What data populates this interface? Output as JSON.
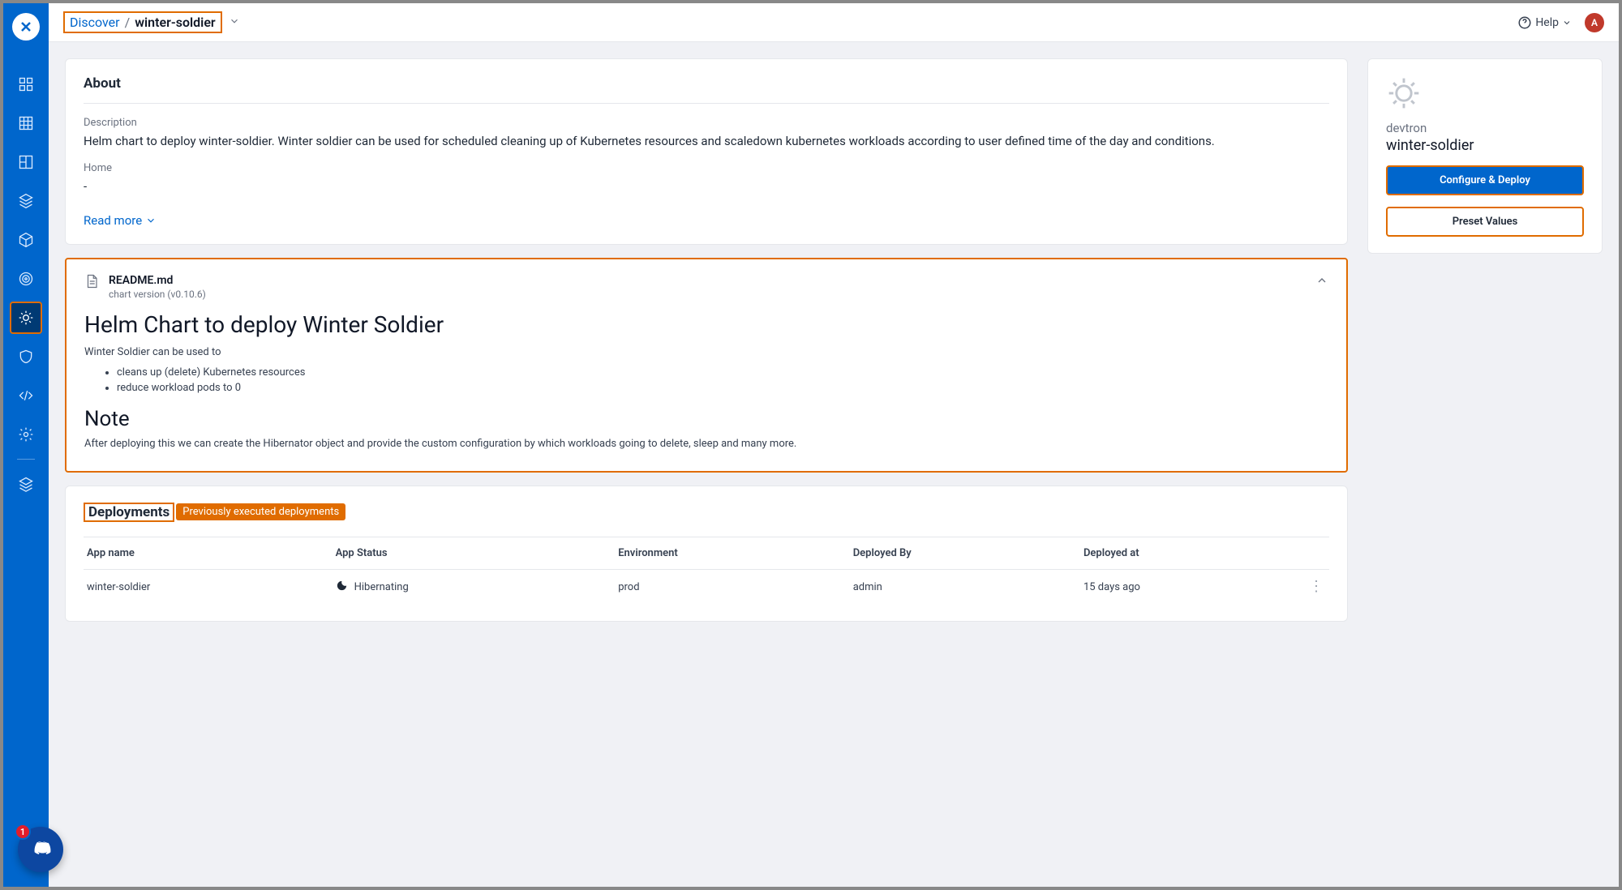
{
  "breadcrumb": {
    "root": "Discover",
    "current": "winter-soldier"
  },
  "topbar": {
    "help_label": "Help",
    "avatar_initial": "A"
  },
  "discord_badge": "1",
  "about": {
    "title": "About",
    "description_label": "Description",
    "description": "Helm chart to deploy winter-soldier. Winter soldier can be used for scheduled cleaning up of Kubernetes resources and scaledown kubernetes workloads according to user defined time of the day and conditions.",
    "home_label": "Home",
    "home_value": "-",
    "read_more": "Read more"
  },
  "readme": {
    "filename": "README.md",
    "version": "chart version (v0.10.6)",
    "h1": "Helm Chart to deploy Winter Soldier",
    "intro": "Winter Soldier can be used to",
    "bullets": [
      "cleans up (delete) Kubernetes resources",
      "reduce workload pods to 0"
    ],
    "note_title": "Note",
    "note_body": "After deploying this we can create the Hibernator object and provide the custom configuration by which workloads going to delete, sleep and many more."
  },
  "deployments": {
    "title": "Deployments",
    "hint": "Previously executed deployments",
    "columns": [
      "App name",
      "App Status",
      "Environment",
      "Deployed By",
      "Deployed at"
    ],
    "rows": [
      {
        "app": "winter-soldier",
        "status": "Hibernating",
        "env": "prod",
        "by": "admin",
        "at": "15 days ago"
      }
    ]
  },
  "chart_panel": {
    "repo": "devtron",
    "name": "winter-soldier",
    "configure_btn": "Configure & Deploy",
    "preset_btn": "Preset Values"
  }
}
